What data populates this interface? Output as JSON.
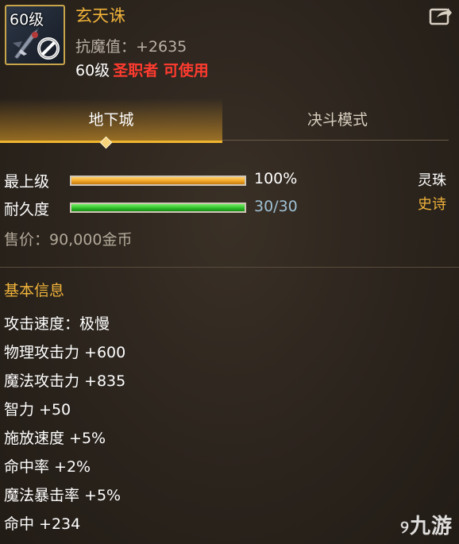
{
  "item": {
    "level_badge": "60级",
    "name": "玄天诛",
    "stat": "抗魔值：+2635",
    "req_level": "60级",
    "req_class": "圣职者 可使用"
  },
  "tabs": [
    {
      "label": "地下城",
      "active": true
    },
    {
      "label": "决斗模式",
      "active": false
    }
  ],
  "upgrade": {
    "label": "最上级",
    "value_text": "100%",
    "fill_fraction": 1.0,
    "fill_color": "#f0a526"
  },
  "durability": {
    "label": "耐久度",
    "value_text": "30/30",
    "fill_fraction": 1.0,
    "fill_color": "#2fbf2a"
  },
  "orb": {
    "label": "灵珠",
    "rarity": "史诗"
  },
  "price": "售价：90,000金币",
  "basic_info": {
    "title": "基本信息",
    "attributes": [
      "攻击速度：极慢",
      "物理攻击力 +600",
      "魔法攻击力 +835",
      "智力 +50",
      "施放速度 +5%",
      "命中率 +2%",
      "魔法暴击率 +5%",
      "命中 +234"
    ]
  },
  "colors": {
    "name": "#f0b33a",
    "class_requirement": "#ff3b2f",
    "rarity_epic": "#f0b33a",
    "durability_value": "#9fc1d6"
  },
  "icons": [
    "forbidden-icon",
    "share-icon",
    "weapon-icon"
  ],
  "watermark": "九游"
}
